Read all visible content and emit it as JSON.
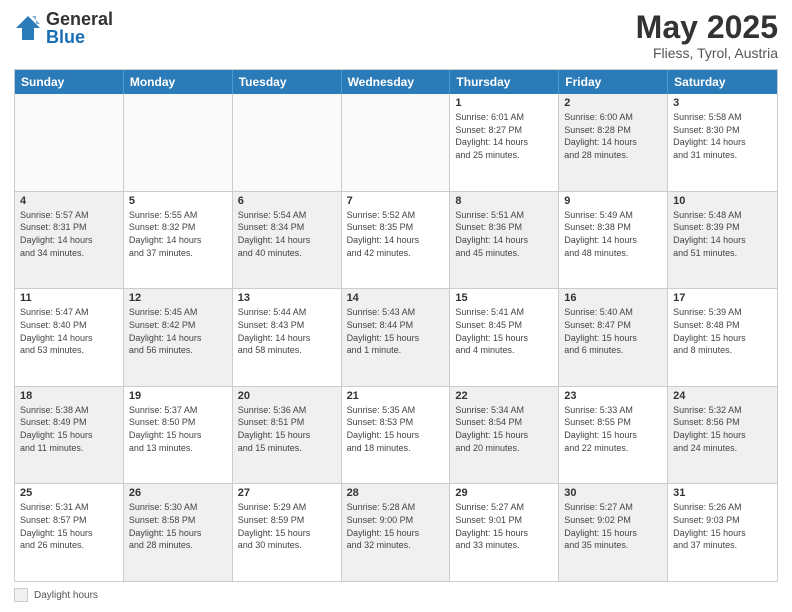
{
  "logo": {
    "general": "General",
    "blue": "Blue"
  },
  "title": {
    "month": "May 2025",
    "location": "Fliess, Tyrol, Austria"
  },
  "weekdays": [
    "Sunday",
    "Monday",
    "Tuesday",
    "Wednesday",
    "Thursday",
    "Friday",
    "Saturday"
  ],
  "legend": {
    "label": "Daylight hours"
  },
  "rows": [
    [
      {
        "day": "",
        "info": "",
        "empty": true
      },
      {
        "day": "",
        "info": "",
        "empty": true
      },
      {
        "day": "",
        "info": "",
        "empty": true
      },
      {
        "day": "",
        "info": "",
        "empty": true
      },
      {
        "day": "1",
        "info": "Sunrise: 6:01 AM\nSunset: 8:27 PM\nDaylight: 14 hours\nand 25 minutes.",
        "shaded": false
      },
      {
        "day": "2",
        "info": "Sunrise: 6:00 AM\nSunset: 8:28 PM\nDaylight: 14 hours\nand 28 minutes.",
        "shaded": true
      },
      {
        "day": "3",
        "info": "Sunrise: 5:58 AM\nSunset: 8:30 PM\nDaylight: 14 hours\nand 31 minutes.",
        "shaded": false
      }
    ],
    [
      {
        "day": "4",
        "info": "Sunrise: 5:57 AM\nSunset: 8:31 PM\nDaylight: 14 hours\nand 34 minutes.",
        "shaded": true
      },
      {
        "day": "5",
        "info": "Sunrise: 5:55 AM\nSunset: 8:32 PM\nDaylight: 14 hours\nand 37 minutes.",
        "shaded": false
      },
      {
        "day": "6",
        "info": "Sunrise: 5:54 AM\nSunset: 8:34 PM\nDaylight: 14 hours\nand 40 minutes.",
        "shaded": true
      },
      {
        "day": "7",
        "info": "Sunrise: 5:52 AM\nSunset: 8:35 PM\nDaylight: 14 hours\nand 42 minutes.",
        "shaded": false
      },
      {
        "day": "8",
        "info": "Sunrise: 5:51 AM\nSunset: 8:36 PM\nDaylight: 14 hours\nand 45 minutes.",
        "shaded": true
      },
      {
        "day": "9",
        "info": "Sunrise: 5:49 AM\nSunset: 8:38 PM\nDaylight: 14 hours\nand 48 minutes.",
        "shaded": false
      },
      {
        "day": "10",
        "info": "Sunrise: 5:48 AM\nSunset: 8:39 PM\nDaylight: 14 hours\nand 51 minutes.",
        "shaded": true
      }
    ],
    [
      {
        "day": "11",
        "info": "Sunrise: 5:47 AM\nSunset: 8:40 PM\nDaylight: 14 hours\nand 53 minutes.",
        "shaded": false
      },
      {
        "day": "12",
        "info": "Sunrise: 5:45 AM\nSunset: 8:42 PM\nDaylight: 14 hours\nand 56 minutes.",
        "shaded": true
      },
      {
        "day": "13",
        "info": "Sunrise: 5:44 AM\nSunset: 8:43 PM\nDaylight: 14 hours\nand 58 minutes.",
        "shaded": false
      },
      {
        "day": "14",
        "info": "Sunrise: 5:43 AM\nSunset: 8:44 PM\nDaylight: 15 hours\nand 1 minute.",
        "shaded": true
      },
      {
        "day": "15",
        "info": "Sunrise: 5:41 AM\nSunset: 8:45 PM\nDaylight: 15 hours\nand 4 minutes.",
        "shaded": false
      },
      {
        "day": "16",
        "info": "Sunrise: 5:40 AM\nSunset: 8:47 PM\nDaylight: 15 hours\nand 6 minutes.",
        "shaded": true
      },
      {
        "day": "17",
        "info": "Sunrise: 5:39 AM\nSunset: 8:48 PM\nDaylight: 15 hours\nand 8 minutes.",
        "shaded": false
      }
    ],
    [
      {
        "day": "18",
        "info": "Sunrise: 5:38 AM\nSunset: 8:49 PM\nDaylight: 15 hours\nand 11 minutes.",
        "shaded": true
      },
      {
        "day": "19",
        "info": "Sunrise: 5:37 AM\nSunset: 8:50 PM\nDaylight: 15 hours\nand 13 minutes.",
        "shaded": false
      },
      {
        "day": "20",
        "info": "Sunrise: 5:36 AM\nSunset: 8:51 PM\nDaylight: 15 hours\nand 15 minutes.",
        "shaded": true
      },
      {
        "day": "21",
        "info": "Sunrise: 5:35 AM\nSunset: 8:53 PM\nDaylight: 15 hours\nand 18 minutes.",
        "shaded": false
      },
      {
        "day": "22",
        "info": "Sunrise: 5:34 AM\nSunset: 8:54 PM\nDaylight: 15 hours\nand 20 minutes.",
        "shaded": true
      },
      {
        "day": "23",
        "info": "Sunrise: 5:33 AM\nSunset: 8:55 PM\nDaylight: 15 hours\nand 22 minutes.",
        "shaded": false
      },
      {
        "day": "24",
        "info": "Sunrise: 5:32 AM\nSunset: 8:56 PM\nDaylight: 15 hours\nand 24 minutes.",
        "shaded": true
      }
    ],
    [
      {
        "day": "25",
        "info": "Sunrise: 5:31 AM\nSunset: 8:57 PM\nDaylight: 15 hours\nand 26 minutes.",
        "shaded": false
      },
      {
        "day": "26",
        "info": "Sunrise: 5:30 AM\nSunset: 8:58 PM\nDaylight: 15 hours\nand 28 minutes.",
        "shaded": true
      },
      {
        "day": "27",
        "info": "Sunrise: 5:29 AM\nSunset: 8:59 PM\nDaylight: 15 hours\nand 30 minutes.",
        "shaded": false
      },
      {
        "day": "28",
        "info": "Sunrise: 5:28 AM\nSunset: 9:00 PM\nDaylight: 15 hours\nand 32 minutes.",
        "shaded": true
      },
      {
        "day": "29",
        "info": "Sunrise: 5:27 AM\nSunset: 9:01 PM\nDaylight: 15 hours\nand 33 minutes.",
        "shaded": false
      },
      {
        "day": "30",
        "info": "Sunrise: 5:27 AM\nSunset: 9:02 PM\nDaylight: 15 hours\nand 35 minutes.",
        "shaded": true
      },
      {
        "day": "31",
        "info": "Sunrise: 5:26 AM\nSunset: 9:03 PM\nDaylight: 15 hours\nand 37 minutes.",
        "shaded": false
      }
    ]
  ]
}
